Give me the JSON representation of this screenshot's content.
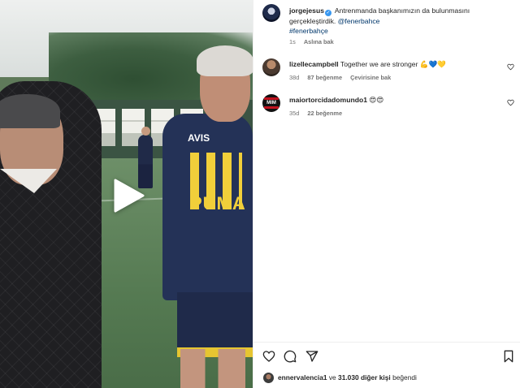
{
  "post": {
    "username": "jorgejesus",
    "caption": "Antrenmanda başkanımızın da bulunmasını gerçekleştirdik.",
    "mention": "@fenerbahce",
    "hashtag": "#fenerbahçe",
    "time": "1s",
    "see_original": "Aslına bak"
  },
  "comments": [
    {
      "username": "lizellecampbell",
      "text": "Together we are stronger",
      "emojis": "💪💙💛",
      "time": "38d",
      "likes": "87 beğenme",
      "action": "Çevirisine bak"
    },
    {
      "username": "maiortorcidadomundo1",
      "text": "",
      "emojis": "😍😍",
      "time": "35d",
      "likes": "22 beğenme"
    }
  ],
  "avatar_badge": "MIM",
  "likes_summary": {
    "user": "ennervalencia1",
    "middle": " ve ",
    "count": "31.030 diğer kişi",
    "suffix": " beğendi"
  },
  "colors": {
    "verified": "#3897f0",
    "link": "#00376b",
    "muted": "#737373",
    "jersey_yellow": "#f1cf3a",
    "jersey_navy": "#243257"
  },
  "video_overlay": {
    "avis": "AVIS",
    "puma": "PUMA"
  },
  "icons": [
    "play-icon",
    "heart-icon",
    "comment-icon",
    "share-icon",
    "bookmark-icon",
    "verified-icon"
  ]
}
